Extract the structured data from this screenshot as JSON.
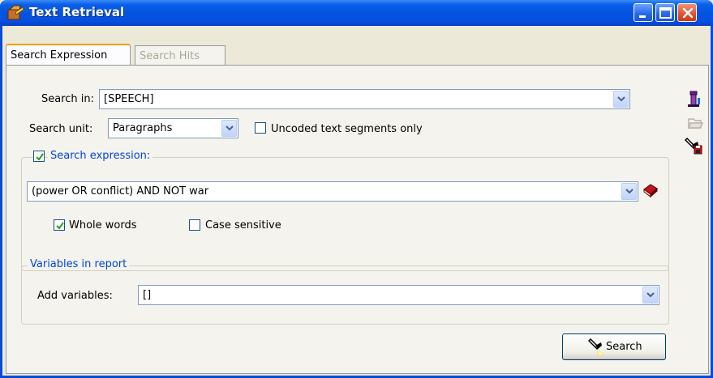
{
  "window": {
    "title": "Text Retrieval"
  },
  "tabs": [
    {
      "label": "Search Expression",
      "active": true
    },
    {
      "label": "Search Hits",
      "active": false
    }
  ],
  "search_in": {
    "label": "Search in:",
    "value": "[SPEECH]"
  },
  "search_unit": {
    "label": "Search unit:",
    "value": "Paragraphs",
    "uncoded_only_label": "Uncoded text segments only",
    "uncoded_only_checked": false
  },
  "expression_group": {
    "enabled": true,
    "title": "Search expression:",
    "value": "(power OR conflict) AND NOT war",
    "whole_words_label": "Whole words",
    "whole_words_checked": true,
    "case_sensitive_label": "Case sensitive",
    "case_sensitive_checked": false
  },
  "variables_group": {
    "title": "Variables in report",
    "add_label": "Add variables:",
    "value": "[]"
  },
  "actions": {
    "search_label": "Search"
  },
  "side_icons": [
    "filter-column-icon",
    "open-folder-icon",
    "save-search-icon"
  ],
  "colors": {
    "titlebar": "#0554e0",
    "group_title": "#0046d5",
    "panel_bg": "#f4f3ee",
    "window_bg": "#ece9d8"
  }
}
